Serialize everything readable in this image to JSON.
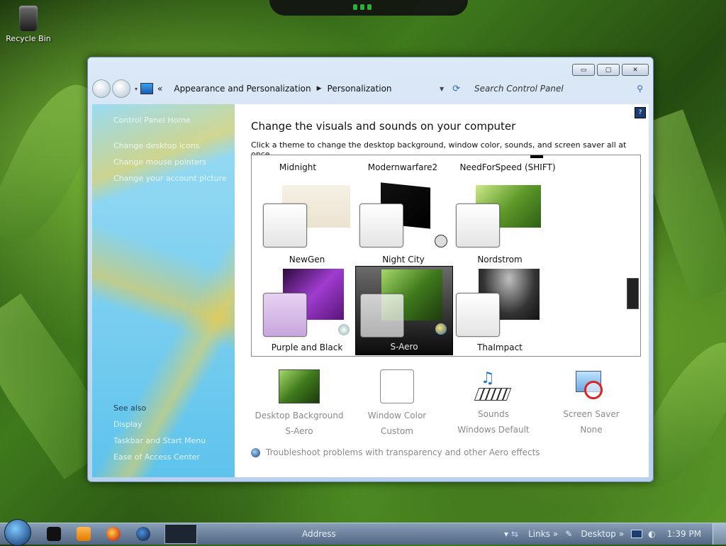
{
  "desktop": {
    "icon_label": "Recycle Bin"
  },
  "window": {
    "buttons": {
      "minimize": "▭",
      "maximize": "▢",
      "close": "✕"
    },
    "breadcrumb": [
      "Appearance and Personalization",
      "Personalization"
    ],
    "crumb_prefix": "«",
    "search_placeholder": "Search Control Panel"
  },
  "sidebar": {
    "links": [
      "Control Panel Home",
      "Change desktop icons",
      "Change mouse pointers",
      "Change your account picture"
    ],
    "see_also_title": "See also",
    "see_also": [
      "Display",
      "Taskbar and Start Menu",
      "Ease of Access Center"
    ]
  },
  "main": {
    "heading": "Change the visuals and sounds on your computer",
    "subheading": "Click a theme to change the desktop background, window color, sounds, and screen saver all at once.",
    "row1_labels": [
      "Midnight",
      "Modernwarfare2",
      "NeedForSpeed (SHIFT)"
    ],
    "themes_row2": [
      "NewGen",
      "Night City",
      "Nordstrom"
    ],
    "themes_row3": [
      "Purple and Black",
      "S-Aero",
      "ThaImpact"
    ],
    "selected_theme": "S-Aero",
    "settings": [
      {
        "title": "Desktop Background",
        "value": "S-Aero",
        "icon": "leaf-background-icon"
      },
      {
        "title": "Window Color",
        "value": "Custom",
        "icon": "window-color-icon"
      },
      {
        "title": "Sounds",
        "value": "Windows Default",
        "icon": "music-keyboard-icon"
      },
      {
        "title": "Screen Saver",
        "value": "None",
        "icon": "no-screensaver-icon"
      }
    ],
    "troubleshoot": "Troubleshoot problems with transparency and other Aero effects"
  },
  "taskbar": {
    "address_label": "Address",
    "links_label": "Links",
    "desktop_label": "Desktop",
    "chevron": "»",
    "clock": "1:39 PM"
  }
}
